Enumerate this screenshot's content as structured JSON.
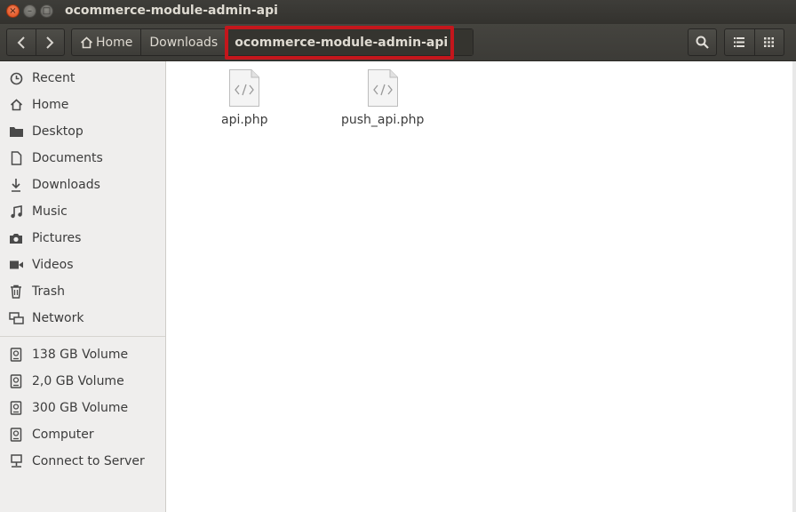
{
  "window": {
    "title": "ocommerce-module-admin-api",
    "close_glyph": "×",
    "minimize_glyph": "–",
    "maximize_glyph": "□"
  },
  "toolbar": {
    "back_icon": "chevron-left-icon",
    "forward_icon": "chevron-right-icon",
    "breadcrumbs": [
      {
        "label": "Home",
        "icon": "home-icon"
      },
      {
        "label": "Downloads"
      },
      {
        "label": "ocommerce-module-admin-api",
        "current": true
      }
    ],
    "search_icon": "search-icon",
    "list_view_icon": "list-view-icon",
    "grid_view_icon": "grid-view-icon",
    "highlight_color": "#c4161c"
  },
  "sidebar": {
    "places": [
      {
        "label": "Recent",
        "icon": "clock-icon"
      },
      {
        "label": "Home",
        "icon": "home-icon"
      },
      {
        "label": "Desktop",
        "icon": "folder-icon"
      },
      {
        "label": "Documents",
        "icon": "document-icon"
      },
      {
        "label": "Downloads",
        "icon": "download-icon"
      },
      {
        "label": "Music",
        "icon": "music-icon"
      },
      {
        "label": "Pictures",
        "icon": "camera-icon"
      },
      {
        "label": "Videos",
        "icon": "video-icon"
      },
      {
        "label": "Trash",
        "icon": "trash-icon"
      },
      {
        "label": "Network",
        "icon": "network-icon"
      }
    ],
    "devices": [
      {
        "label": "138 GB Volume",
        "icon": "drive-icon"
      },
      {
        "label": "2,0 GB Volume",
        "icon": "drive-icon"
      },
      {
        "label": "300 GB Volume",
        "icon": "drive-icon"
      },
      {
        "label": "Computer",
        "icon": "drive-icon"
      },
      {
        "label": "Connect to Server",
        "icon": "server-icon"
      }
    ]
  },
  "files": [
    {
      "name": "api.php",
      "icon": "php-file-icon"
    },
    {
      "name": "push_api.php",
      "icon": "php-file-icon"
    }
  ]
}
